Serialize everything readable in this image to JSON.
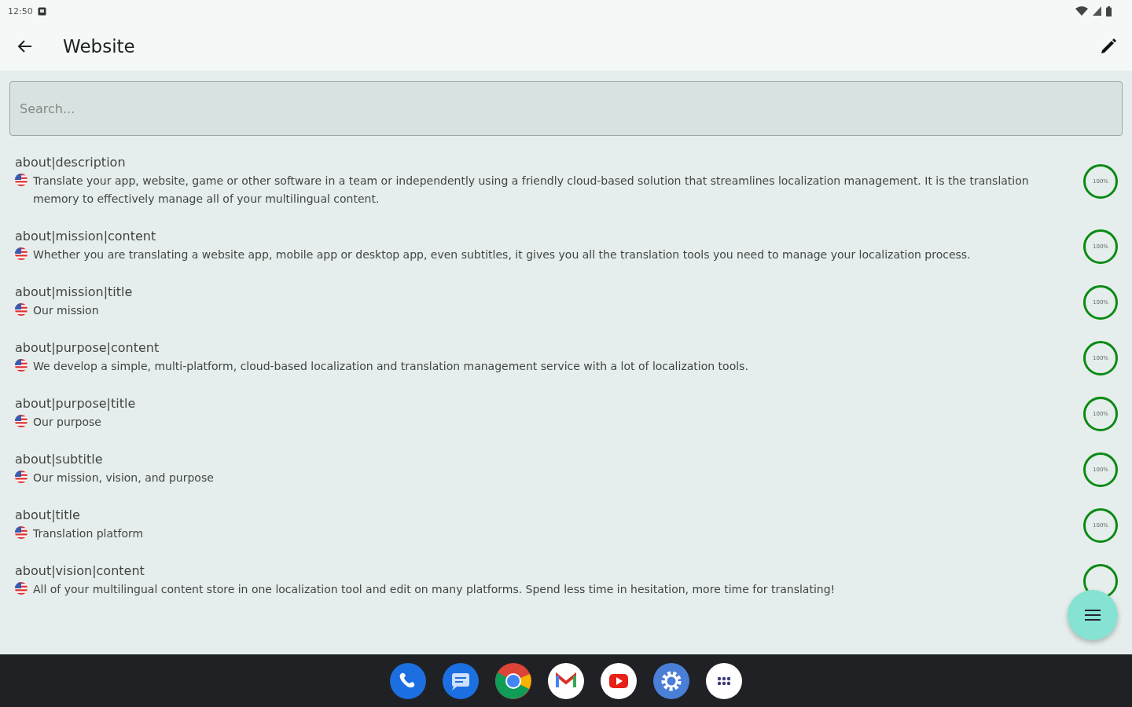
{
  "status_bar": {
    "time": "12:50"
  },
  "app_bar": {
    "title": "Website"
  },
  "search": {
    "placeholder": "Search..."
  },
  "rows": [
    {
      "key": "about|description",
      "text": "Translate your app, website, game or other software in a team or independently using a friendly cloud-based solution that streamlines localization management. It is the translation memory to effectively manage all of your multilingual content.",
      "progress": "100%"
    },
    {
      "key": "about|mission|content",
      "text": "Whether you are translating a website app, mobile app or desktop app, even subtitles, it gives you all the translation tools you need to manage your localization process.",
      "progress": "100%"
    },
    {
      "key": "about|mission|title",
      "text": "Our mission",
      "progress": "100%"
    },
    {
      "key": "about|purpose|content",
      "text": "We develop a simple, multi-platform, cloud-based localization and translation management service with a lot of localization tools.",
      "progress": "100%"
    },
    {
      "key": "about|purpose|title",
      "text": "Our purpose",
      "progress": "100%"
    },
    {
      "key": "about|subtitle",
      "text": "Our mission, vision, and purpose",
      "progress": "100%"
    },
    {
      "key": "about|title",
      "text": "Translation platform",
      "progress": "100%"
    },
    {
      "key": "about|vision|content",
      "text": "All of your multilingual content store in one localization tool and edit on many platforms. Spend less time in hesitation, more time for translating!"
    }
  ]
}
